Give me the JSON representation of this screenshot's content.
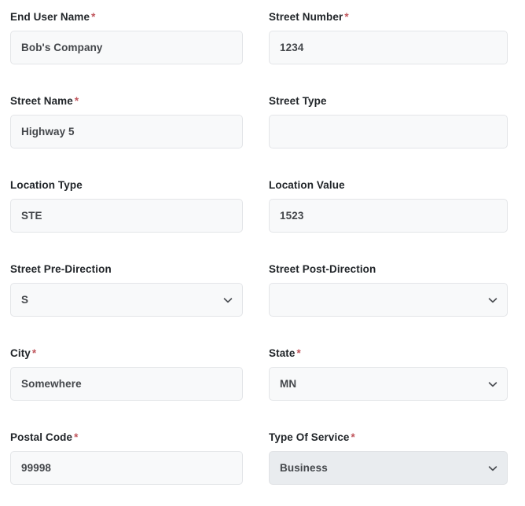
{
  "theme": {
    "page_background": "#ffffff",
    "label_color": "#212529",
    "required_marker_color": "#c0555c",
    "field_background": "#f8f9fa",
    "field_background_disabled": "#e9ecef",
    "field_border": "#e3e5e8",
    "value_color": "#44474b"
  },
  "form": {
    "required_marker": "*",
    "fields": [
      {
        "label": "End User Name",
        "required": true,
        "type": "text",
        "value": "Bob's Company",
        "placeholder": "",
        "disabled": false,
        "column": "left",
        "name": "end-user-name"
      },
      {
        "label": "Street Number",
        "required": true,
        "type": "text",
        "value": "1234",
        "placeholder": "",
        "disabled": false,
        "column": "right",
        "name": "street-number"
      },
      {
        "label": "Street Name",
        "required": true,
        "type": "text",
        "value": "Highway 5",
        "placeholder": "",
        "disabled": false,
        "column": "left",
        "name": "street-name"
      },
      {
        "label": "Street Type",
        "required": false,
        "type": "text",
        "value": "",
        "placeholder": "",
        "disabled": false,
        "column": "right",
        "name": "street-type"
      },
      {
        "label": "Location Type",
        "required": false,
        "type": "text",
        "value": "STE",
        "placeholder": "",
        "disabled": false,
        "column": "left",
        "name": "location-type"
      },
      {
        "label": "Location Value",
        "required": false,
        "type": "text",
        "value": "1523",
        "placeholder": "",
        "disabled": false,
        "column": "right",
        "name": "location-value"
      },
      {
        "label": "Street Pre-Direction",
        "required": false,
        "type": "select",
        "value": "S",
        "placeholder": "",
        "disabled": false,
        "column": "left",
        "name": "street-pre-direction"
      },
      {
        "label": "Street Post-Direction",
        "required": false,
        "type": "select",
        "value": "",
        "placeholder": "",
        "disabled": false,
        "column": "right",
        "name": "street-post-direction"
      },
      {
        "label": "City",
        "required": true,
        "type": "text",
        "value": "Somewhere",
        "placeholder": "",
        "disabled": false,
        "column": "left",
        "name": "city"
      },
      {
        "label": "State",
        "required": true,
        "type": "select",
        "value": "MN",
        "placeholder": "",
        "disabled": false,
        "column": "right",
        "name": "state"
      },
      {
        "label": "Postal Code",
        "required": true,
        "type": "text",
        "value": "99998",
        "placeholder": "",
        "disabled": false,
        "column": "left",
        "name": "postal-code"
      },
      {
        "label": "Type Of Service",
        "required": true,
        "type": "select",
        "value": "Business",
        "placeholder": "",
        "disabled": true,
        "column": "right",
        "name": "type-of-service"
      }
    ]
  },
  "icons": {
    "chevron_down": "chevron-down-icon"
  }
}
